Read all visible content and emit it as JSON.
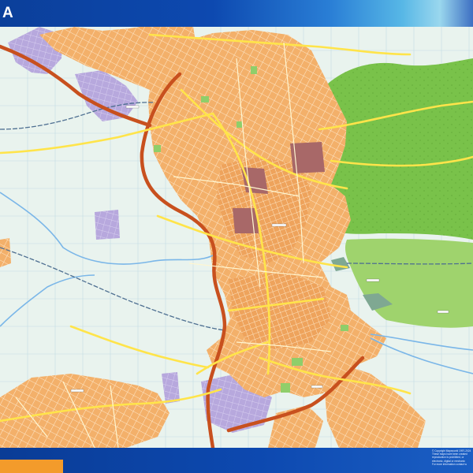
{
  "map": {
    "title": "A",
    "copyright_lines": [
      "© Copyright Mapsworld 1997-2024",
      "These maps have been created",
      "reproduction is prohibited, or",
      "electronic, digital or mechanic",
      "For more information contact w"
    ],
    "colors": {
      "header_blue": "#0d49b0",
      "header_light": "#9ad7ee",
      "background": "#e9f3ee",
      "grid": "#b9d3df",
      "urban": "#f3b06a",
      "urban_dense": "#e99a55",
      "industrial": "#b7a8dd",
      "forest": "#79c24a",
      "forest_light": "#9fd36d",
      "restricted": "#a86868",
      "highway": "#c8501e",
      "main_road": "#ffe44a",
      "railway": "#5a7a9a",
      "river": "#7ab6e8",
      "legend_orange": "#f39b2b"
    }
  }
}
